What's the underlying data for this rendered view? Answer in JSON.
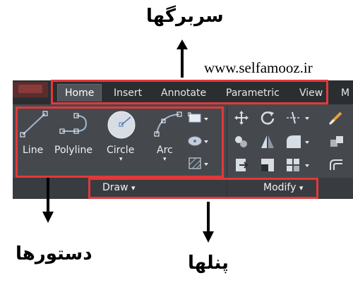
{
  "annotations": {
    "tabs_label": "سربرگها",
    "commands_label": "دستورها",
    "panels_label": "پنلها",
    "website": "www.selfamooz.ir"
  },
  "ribbon": {
    "tabs": [
      "Home",
      "Insert",
      "Annotate",
      "Parametric",
      "View",
      "M"
    ],
    "active_tab": "Home",
    "draw_tools": [
      "Line",
      "Polyline",
      "Circle",
      "Arc"
    ],
    "panels": [
      "Draw",
      "Modify"
    ]
  },
  "colors": {
    "highlight": "#e0393b",
    "ribbon_bg": "#45494e",
    "tabbar_bg": "#2b2e31"
  }
}
